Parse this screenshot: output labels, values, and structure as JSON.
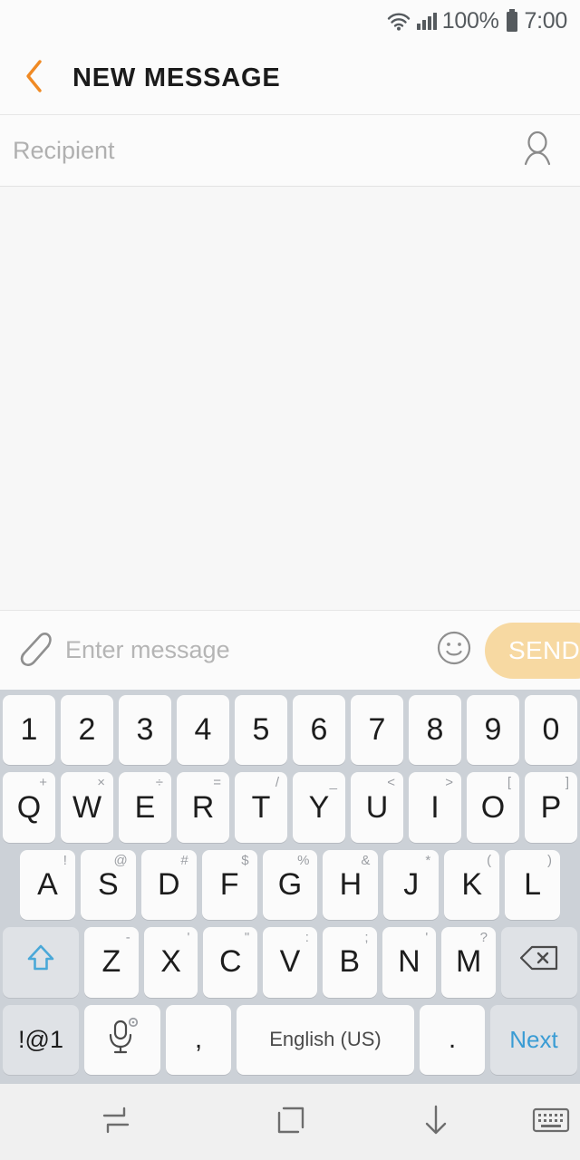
{
  "status_bar": {
    "wifi_icon": "wifi-icon",
    "signal_icon": "signal-bars-icon",
    "battery_percent": "100%",
    "battery_icon": "battery-full-icon",
    "time": "7:00"
  },
  "title_bar": {
    "back_icon": "back-chevron-icon",
    "title": "NEW MESSAGE",
    "accent_color": "#f08a24"
  },
  "recipient": {
    "placeholder": "Recipient",
    "value": "",
    "contact_icon": "contact-person-icon"
  },
  "compose": {
    "attach_icon": "paperclip-icon",
    "placeholder": "Enter message",
    "value": "",
    "emoji_icon": "smiley-face-icon",
    "send_label": "SEND",
    "send_color": "#f7d9a2"
  },
  "keyboard": {
    "language": "English (US)",
    "symbols_label": "!@1",
    "mic_icon": "microphone-icon",
    "settings_icon": "gear-icon",
    "shift_icon": "shift-arrow-icon",
    "backspace_icon": "backspace-icon",
    "next_label": "Next",
    "comma": ",",
    "period": ".",
    "rows": {
      "numbers": [
        {
          "key": "1"
        },
        {
          "key": "2"
        },
        {
          "key": "3"
        },
        {
          "key": "4"
        },
        {
          "key": "5"
        },
        {
          "key": "6"
        },
        {
          "key": "7"
        },
        {
          "key": "8"
        },
        {
          "key": "9"
        },
        {
          "key": "0"
        }
      ],
      "top": [
        {
          "key": "Q",
          "sup": "+"
        },
        {
          "key": "W",
          "sup": "×"
        },
        {
          "key": "E",
          "sup": "÷"
        },
        {
          "key": "R",
          "sup": "="
        },
        {
          "key": "T",
          "sup": "/"
        },
        {
          "key": "Y",
          "sup": "_"
        },
        {
          "key": "U",
          "sup": "<"
        },
        {
          "key": "I",
          "sup": ">"
        },
        {
          "key": "O",
          "sup": "["
        },
        {
          "key": "P",
          "sup": "]"
        }
      ],
      "home": [
        {
          "key": "A",
          "sup": "!"
        },
        {
          "key": "S",
          "sup": "@"
        },
        {
          "key": "D",
          "sup": "#"
        },
        {
          "key": "F",
          "sup": "$"
        },
        {
          "key": "G",
          "sup": "%"
        },
        {
          "key": "H",
          "sup": "&"
        },
        {
          "key": "J",
          "sup": "*"
        },
        {
          "key": "K",
          "sup": "("
        },
        {
          "key": "L",
          "sup": ")"
        }
      ],
      "bottom": [
        {
          "key": "Z",
          "sup": "-"
        },
        {
          "key": "X",
          "sup": "'"
        },
        {
          "key": "C",
          "sup": "\""
        },
        {
          "key": "V",
          "sup": ":"
        },
        {
          "key": "B",
          "sup": ";"
        },
        {
          "key": "N",
          "sup": "'"
        },
        {
          "key": "M",
          "sup": "?"
        }
      ]
    }
  },
  "nav_bar": {
    "recents_icon": "recents-icon",
    "home_icon": "home-square-icon",
    "hide_keyboard_icon": "down-arrow-icon",
    "keyboard_icon": "keyboard-icon"
  }
}
